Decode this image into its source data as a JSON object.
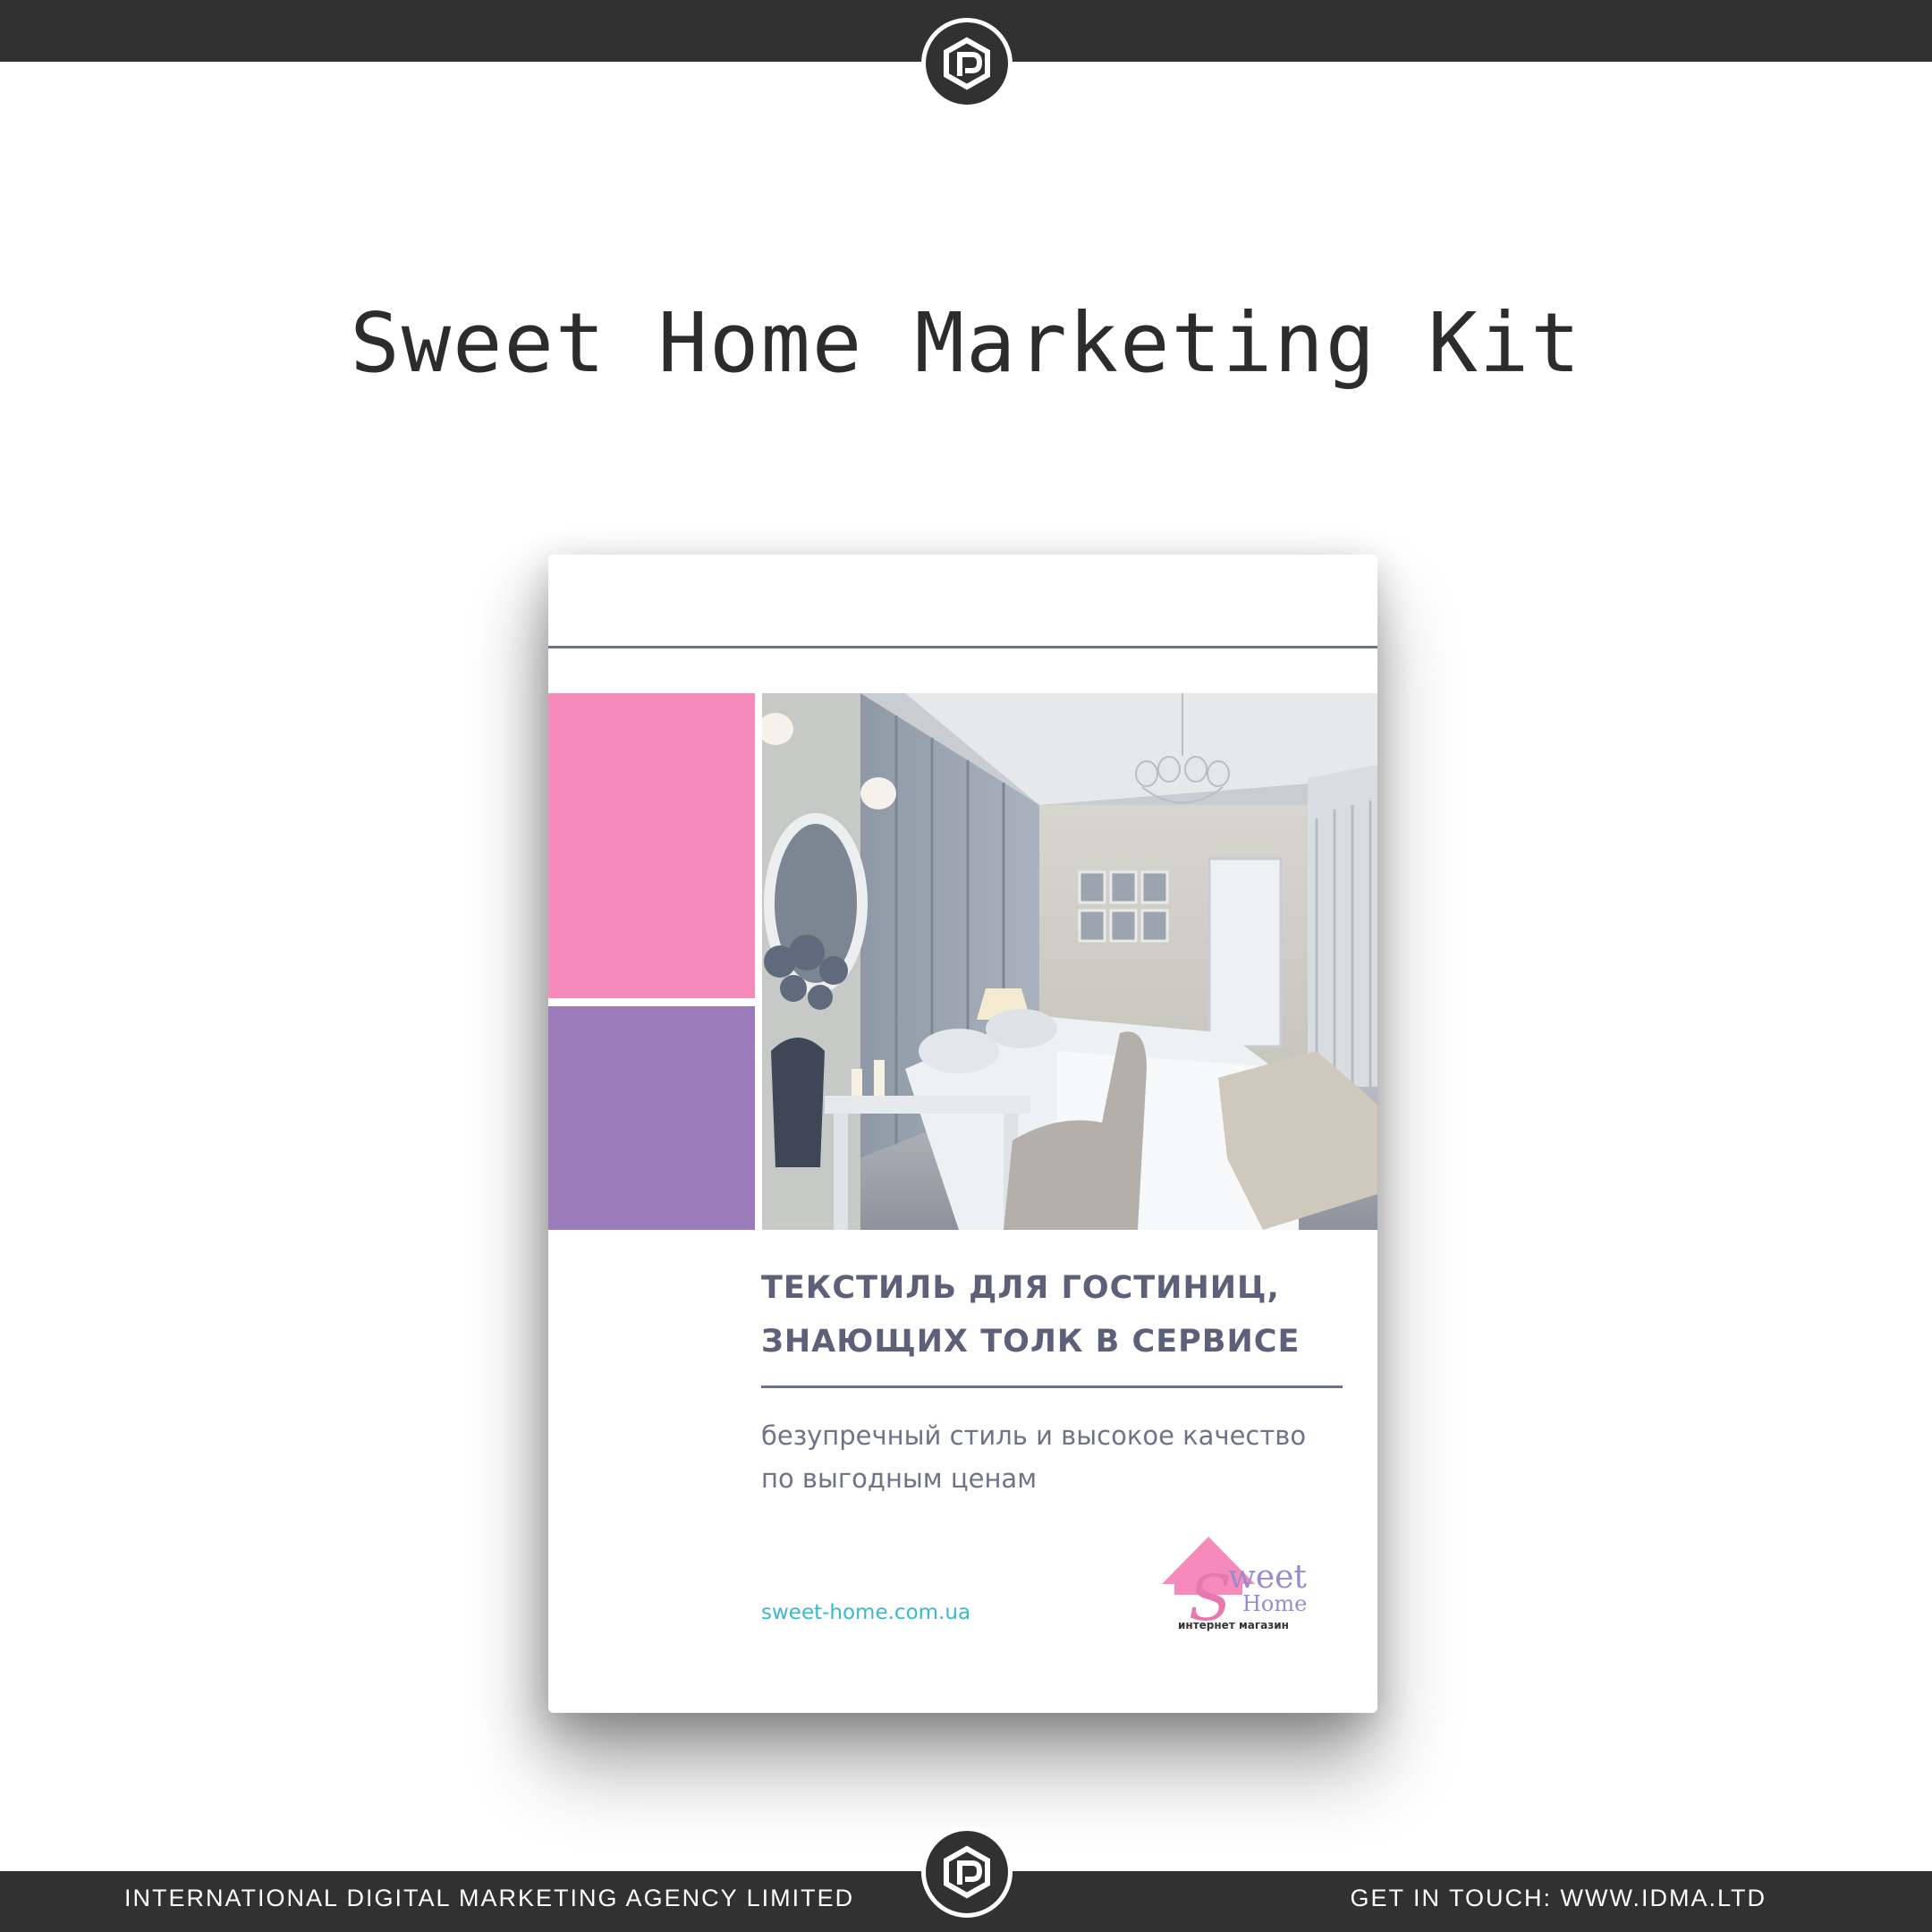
{
  "header": {
    "logo_icon": "agency-logo-icon"
  },
  "page": {
    "title": "Sweet Home Marketing Kit"
  },
  "brochure": {
    "headline_line1": "ТЕКСТИЛЬ ДЛЯ ГОСТИНИЦ,",
    "headline_line2": "ЗНАЮЩИХ ТОЛК В СЕРВИСЕ",
    "subline_line1": "безупречный стиль и высокое качество",
    "subline_line2": "по выгодным ценам",
    "website": "sweet-home.com.ua",
    "logo": {
      "brand_s": "S",
      "brand_weet": "weet",
      "brand_home": "Home",
      "brand_tagline": "интернет магазин"
    },
    "colors": {
      "pink": "#f68bbb",
      "purple": "#9b7bba",
      "headline": "#5c6079",
      "link": "#3ab9c9"
    }
  },
  "footer": {
    "left_text": "INTERNATIONAL DIGITAL MARKETING AGENCY LIMITED",
    "right_text": "GET IN TOUCH: WWW.IDMA.LTD"
  }
}
